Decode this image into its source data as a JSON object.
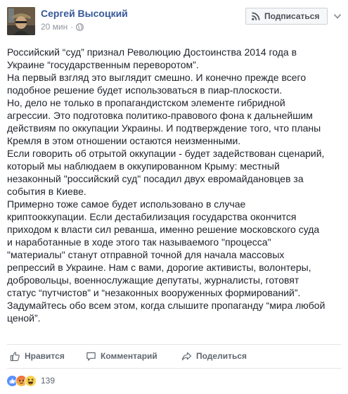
{
  "header": {
    "author": "Сергей Высоцкий",
    "time": "20 мин",
    "separator": "·",
    "subscribe_label": "Подписаться",
    "avatar_icon": "author-photo",
    "privacy_icon": "globe-icon",
    "menu_icon": "chevron-down-icon"
  },
  "post": {
    "lines": [
      "Российский “суд” признал Революцию Достоинства 2014 года в",
      "Украине “государственным переворотом”.",
      "На первый взгляд это выглядит смешно. И конечно прежде всего",
      "подобное решение будет использоваться в пиар-плоскости.",
      "Но, дело не только в пропагандистском элементе гибридной",
      "агрессии. Это подготовка политико-правового фона к дальнейшим",
      "действиям по оккупации Украины. И подтверждение того, что планы",
      "Кремля в этом отношении остаются неизменными.",
      "Если говорить об отрытой оккупации - будет задействован сценарий,",
      "который мы наблюдаем в оккупированном Крыму: местный",
      "незаконный \"российский суд\" посадил двух евромайдановцев за",
      "события в Киеве.",
      "Примерно тоже самое будет использовано в случае",
      "криптооккупации. Если дестабилизация государства окончится",
      "приходом к власти сил реванша, именно решение московского суда",
      "и наработанные в ходе этого так называемого \"процесса\"",
      "\"материалы\" станут отправной точной для начала массовых",
      "репрессий в Украине. Нам с вами, дорогие активисты, волонтеры,",
      "добровольцы, военнослужащие депутаты, журналисты, готовят",
      "статус “путчистов” и “незаконных вооруженных формирований”.",
      "Задумайтесь обо всем этом, когда слышите пропаганду “мира любой",
      "ценой”."
    ]
  },
  "actions": {
    "like_label": "Нравится",
    "comment_label": "Комментарий",
    "share_label": "Поделиться"
  },
  "reactions": {
    "icons": [
      "like-reaction-icon",
      "angry-reaction-icon",
      "haha-reaction-icon"
    ],
    "count": "139"
  },
  "colors": {
    "link": "#365899",
    "text": "#1d2129",
    "muted": "#90949c",
    "like_blue": "#5890ff",
    "angry_orange": "#f0643c",
    "haha_yellow": "#f7d14c"
  }
}
